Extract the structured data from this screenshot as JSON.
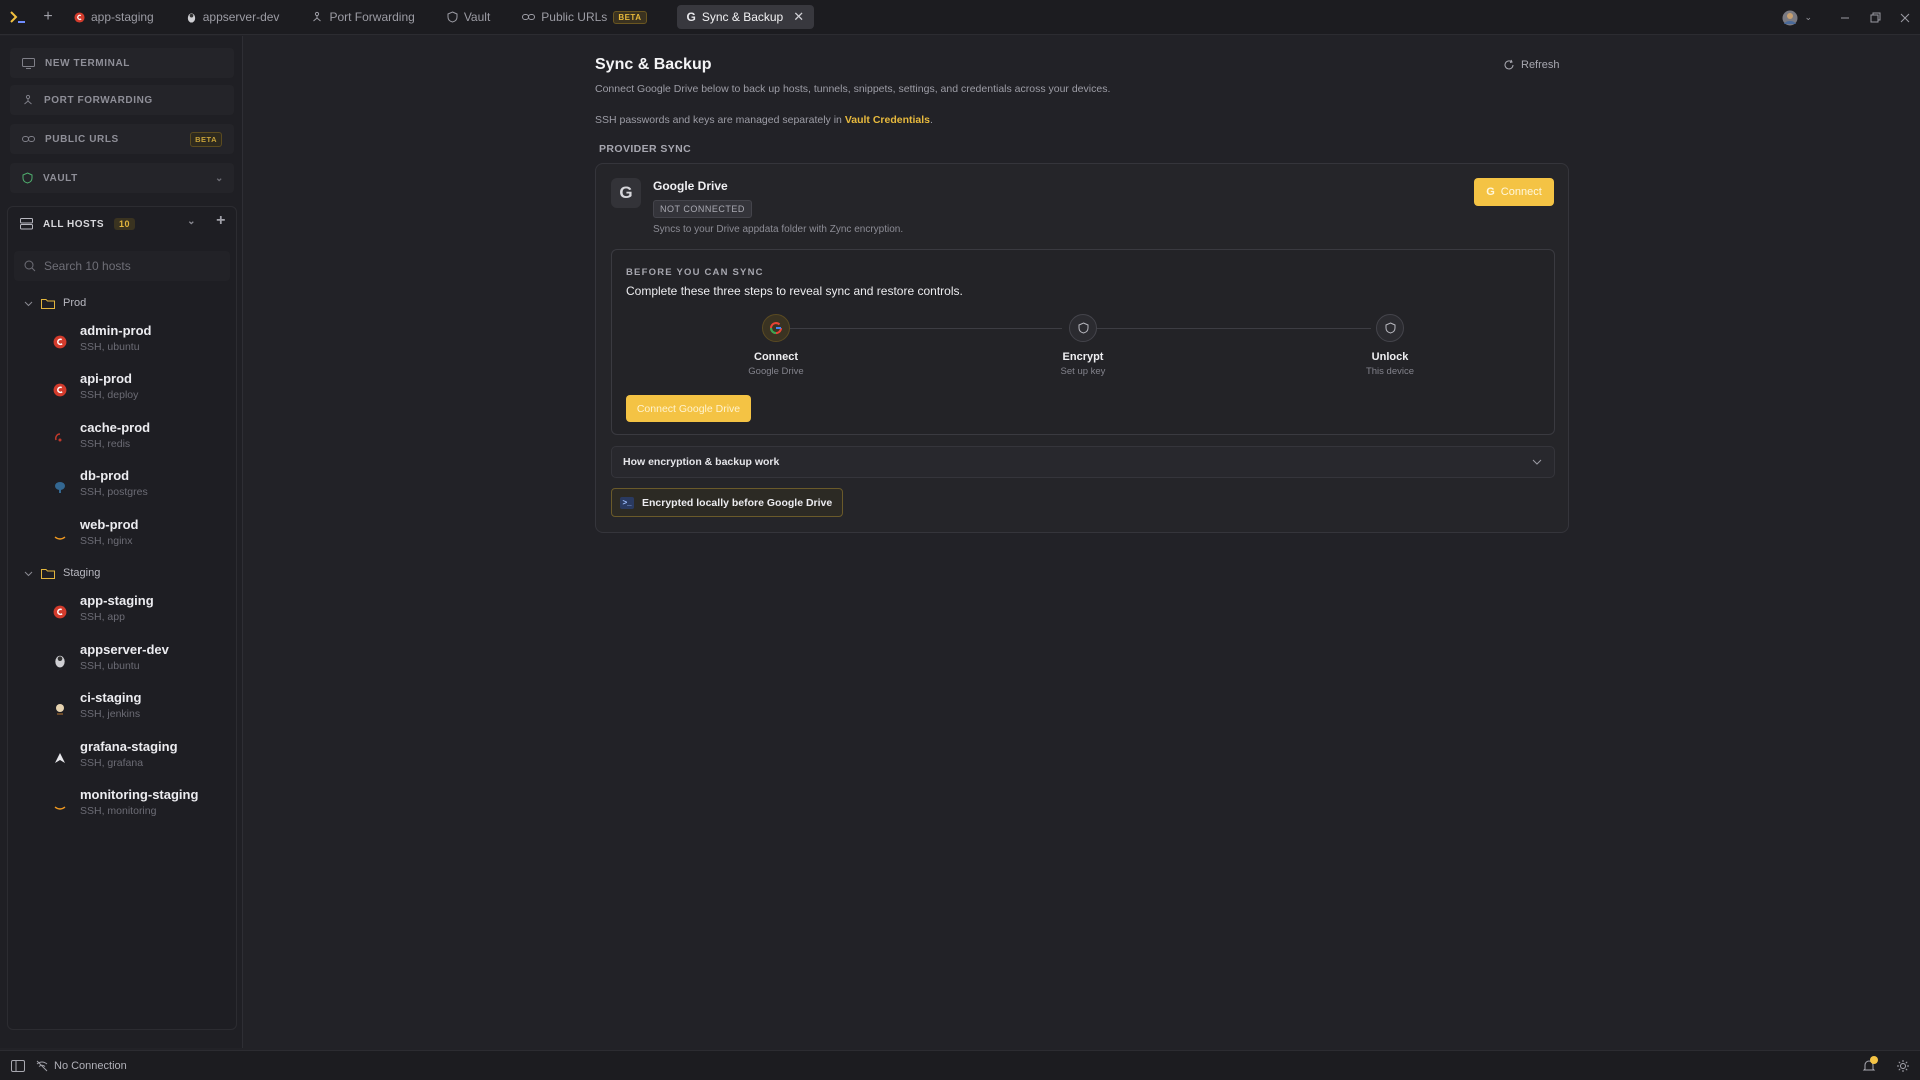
{
  "tabs": [
    {
      "label": "app-staging",
      "icon": "debian-icon"
    },
    {
      "label": "appserver-dev",
      "icon": "linux-icon"
    },
    {
      "label": "Port Forwarding",
      "icon": "port-forward-icon"
    },
    {
      "label": "Vault",
      "icon": "shield-icon"
    },
    {
      "label": "Public URLs",
      "icon": "link-icon",
      "badge": "BETA"
    },
    {
      "label": "Sync & Backup",
      "icon": "google-icon",
      "active": true
    }
  ],
  "sidebar": {
    "nav": [
      {
        "label": "NEW TERMINAL"
      },
      {
        "label": "PORT FORWARDING"
      },
      {
        "label": "PUBLIC URLS",
        "badge": "BETA"
      },
      {
        "label": "VAULT"
      }
    ],
    "hosts_title": "ALL HOSTS",
    "hosts_count": "10",
    "search_placeholder": "Search 10 hosts",
    "groups": [
      {
        "name": "Prod",
        "hosts": [
          {
            "name": "admin-prod",
            "sub": "SSH, ubuntu",
            "icon": "debian-icon"
          },
          {
            "name": "api-prod",
            "sub": "SSH, deploy",
            "icon": "debian-icon"
          },
          {
            "name": "cache-prod",
            "sub": "SSH, redis",
            "icon": "redis-icon"
          },
          {
            "name": "db-prod",
            "sub": "SSH, postgres",
            "icon": "postgres-icon"
          },
          {
            "name": "web-prod",
            "sub": "SSH, nginx",
            "icon": "aws-icon"
          }
        ]
      },
      {
        "name": "Staging",
        "hosts": [
          {
            "name": "app-staging",
            "sub": "SSH, app",
            "icon": "debian-icon"
          },
          {
            "name": "appserver-dev",
            "sub": "SSH, ubuntu",
            "icon": "linux-icon"
          },
          {
            "name": "ci-staging",
            "sub": "SSH, jenkins",
            "icon": "jenkins-icon"
          },
          {
            "name": "grafana-staging",
            "sub": "SSH, grafana",
            "icon": "arch-icon"
          },
          {
            "name": "monitoring-staging",
            "sub": "SSH, monitoring",
            "icon": "aws-icon"
          }
        ]
      }
    ]
  },
  "main": {
    "title": "Sync & Backup",
    "description": "Connect Google Drive below to back up hosts, tunnels, snippets, settings, and credentials across your devices.",
    "vault_note_prefix": "SSH passwords and keys are managed separately in ",
    "vault_link": "Vault Credentials",
    "vault_note_suffix": ".",
    "refresh_label": "Refresh",
    "section_label": "PROVIDER SYNC",
    "provider": {
      "logo_letter": "G",
      "name": "Google Drive",
      "status": "NOT CONNECTED",
      "description": "Syncs to your Drive appdata folder with Zync encryption.",
      "connect_label": "Connect"
    },
    "before_sync": {
      "label": "BEFORE YOU CAN SYNC",
      "title": "Complete these three steps to reveal sync and restore controls.",
      "steps": [
        {
          "title": "Connect",
          "sub": "Google Drive"
        },
        {
          "title": "Encrypt",
          "sub": "Set up key"
        },
        {
          "title": "Unlock",
          "sub": "This device"
        }
      ],
      "button_label": "Connect Google Drive"
    },
    "accordion_label": "How encryption & backup work",
    "chip_label": "Encrypted locally before Google Drive"
  },
  "statusbar": {
    "connection": "No Connection"
  },
  "colors": {
    "accent": "#f4c344",
    "link": "#e7b93d",
    "background": "#222227",
    "sidebar": "#1f1f24"
  }
}
